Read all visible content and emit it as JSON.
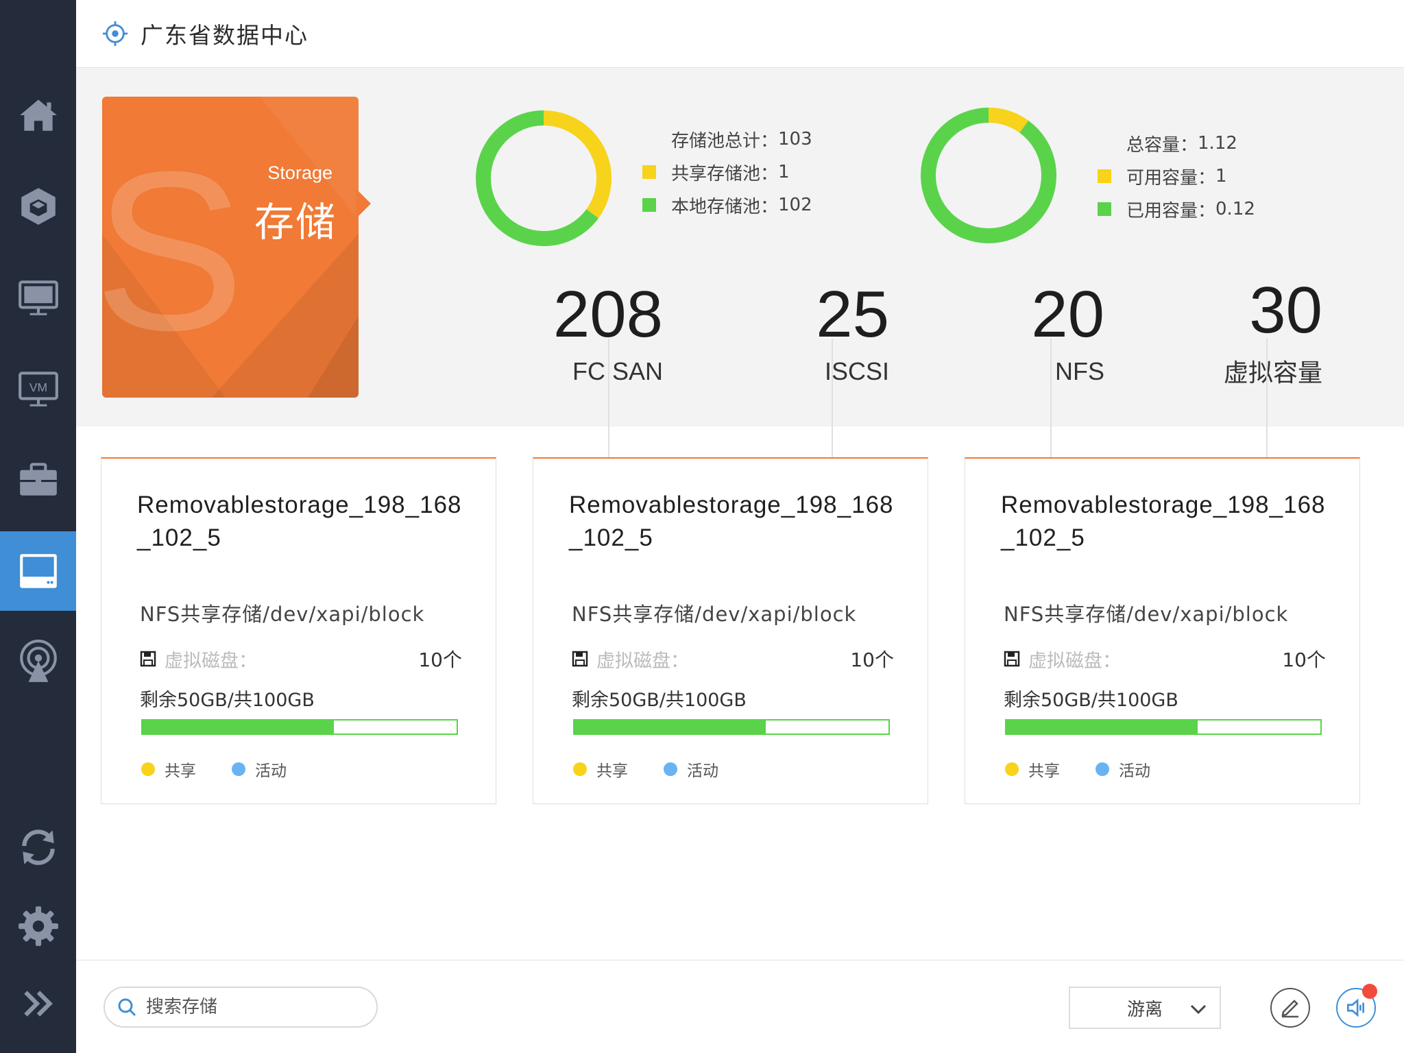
{
  "header": {
    "title": "广东省数据中心"
  },
  "sidebar": {
    "items": [
      {
        "name": "home",
        "icon": "home-icon",
        "active": false
      },
      {
        "name": "resource",
        "icon": "cube-icon",
        "active": false
      },
      {
        "name": "desktop",
        "icon": "monitor-icon",
        "active": false
      },
      {
        "name": "vm",
        "icon": "vm-icon",
        "label": "VM",
        "active": false
      },
      {
        "name": "business",
        "icon": "briefcase-icon",
        "active": false
      },
      {
        "name": "storage",
        "icon": "storage-icon",
        "active": true
      },
      {
        "name": "network",
        "icon": "broadcast-icon",
        "active": false
      },
      {
        "name": "refresh",
        "icon": "refresh-icon",
        "active": false
      },
      {
        "name": "settings",
        "icon": "gear-icon",
        "active": false
      },
      {
        "name": "expand",
        "icon": "double-chevron-right-icon",
        "active": false
      }
    ]
  },
  "storage_card": {
    "label_en": "Storage",
    "label_zh": "存储",
    "watermark": "S"
  },
  "pool_summary": {
    "total_label": "存储池总计：",
    "total_value": "103",
    "shared_label": "共享存储池：",
    "shared_value": "1",
    "local_label": "本地存储池：",
    "local_value": "102"
  },
  "capacity_summary": {
    "total_label": "总容量：",
    "total_value": "1.12",
    "available_label": "可用容量：",
    "available_value": "1",
    "used_label": "已用容量：",
    "used_value": "0.12"
  },
  "chart_data": [
    {
      "type": "pie",
      "donut": true,
      "series": [
        {
          "name": "共享存储池",
          "value": 35,
          "color": "#f7d31b"
        },
        {
          "name": "本地存储池",
          "value": 65,
          "color": "#5ad34a"
        }
      ]
    },
    {
      "type": "pie",
      "donut": true,
      "series": [
        {
          "name": "可用容量",
          "value": 10,
          "color": "#f7d31b"
        },
        {
          "name": "已用容量",
          "value": 90,
          "color": "#5ad34a"
        }
      ]
    }
  ],
  "stats": [
    {
      "value": "208",
      "label": "FC SAN"
    },
    {
      "value": "25",
      "label": "ISCSI"
    },
    {
      "value": "20",
      "label": "NFS"
    },
    {
      "value": "30",
      "label": "虚拟容量"
    }
  ],
  "cards": [
    {
      "name": "Removablestorage_198_168_102_5",
      "path": "NFS共享存储/dev/xapi/block",
      "vdisk_label": "虚拟磁盘：",
      "vdisk_count": "10个",
      "capacity": "剩余50GB/共100GB",
      "used_fraction": 0.61,
      "tag_shared": "共享",
      "tag_active": "活动"
    },
    {
      "name": "Removablestorage_198_168_102_5",
      "path": "NFS共享存储/dev/xapi/block",
      "vdisk_label": "虚拟磁盘：",
      "vdisk_count": "10个",
      "capacity": "剩余50GB/共100GB",
      "used_fraction": 0.61,
      "tag_shared": "共享",
      "tag_active": "活动"
    },
    {
      "name": "Removablestorage_198_168_102_5",
      "path": "NFS共享存储/dev/xapi/block",
      "vdisk_label": "虚拟磁盘：",
      "vdisk_count": "10个",
      "capacity": "剩余50GB/共100GB",
      "used_fraction": 0.61,
      "tag_shared": "共享",
      "tag_active": "活动"
    }
  ],
  "colors": {
    "accent": "#f07a36",
    "active_blue": "#3f8ed6",
    "green": "#5ad34a",
    "yellow": "#f7d31b",
    "dot_blue": "#6ab3f2",
    "sidebar_bg": "#242b3b"
  },
  "bottom": {
    "search_placeholder": "搜索存储",
    "select_value": "游离"
  }
}
